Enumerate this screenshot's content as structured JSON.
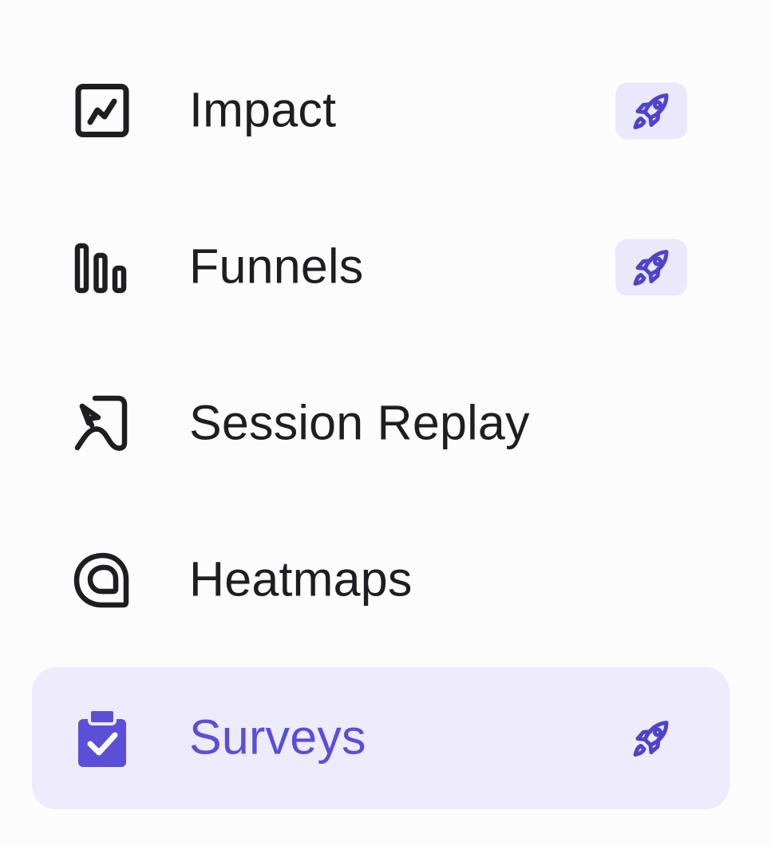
{
  "colors": {
    "text": "#1e1e22",
    "accent": "#5a4fd6",
    "active_background": "#eeebfc",
    "badge_background": "#ebe8fb"
  },
  "nav": {
    "items": [
      {
        "label": "Impact",
        "icon": "trending-chart-icon",
        "badge": "rocket-icon",
        "active": false
      },
      {
        "label": "Funnels",
        "icon": "funnel-bars-icon",
        "badge": "rocket-icon",
        "active": false
      },
      {
        "label": "Session Replay",
        "icon": "session-replay-icon",
        "badge": null,
        "active": false
      },
      {
        "label": "Heatmaps",
        "icon": "heatmap-icon",
        "badge": null,
        "active": false
      },
      {
        "label": "Surveys",
        "icon": "clipboard-check-icon",
        "badge": "rocket-icon",
        "active": true
      }
    ]
  }
}
